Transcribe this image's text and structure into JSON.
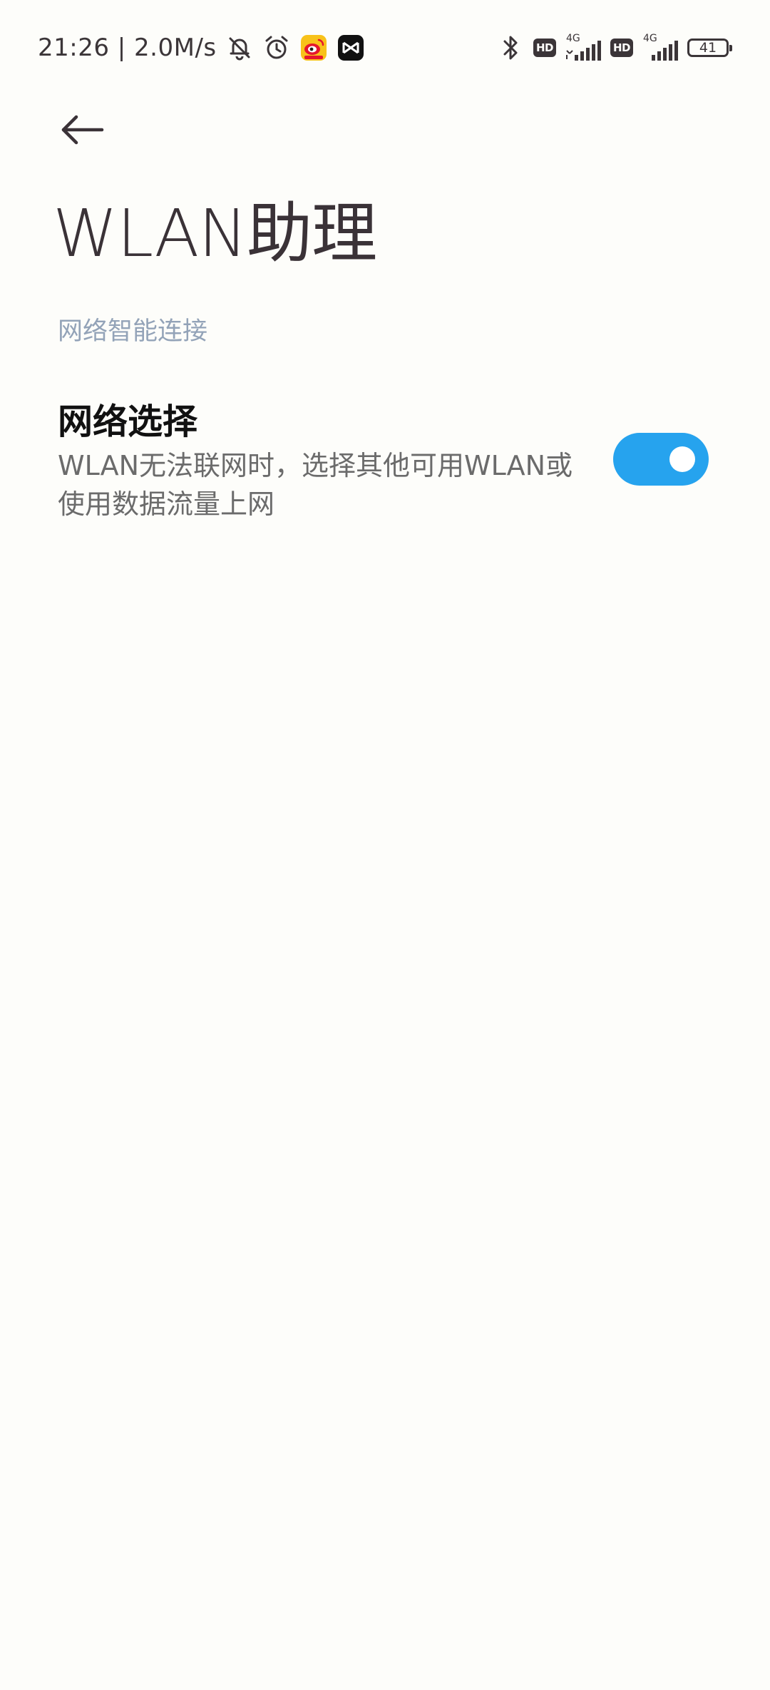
{
  "status_bar": {
    "time_speed": "21:26 | 2.0M/s",
    "icons": [
      "bell-off-icon",
      "alarm-icon",
      "weibo-app-icon",
      "capcut-app-icon",
      "bluetooth-icon",
      "hd-icon",
      "signal-icon",
      "hd-icon",
      "signal-icon",
      "battery-icon"
    ],
    "hd_label": "HD",
    "network_type": "4G",
    "battery_level": "41"
  },
  "header": {
    "back_icon": "arrow-left-icon",
    "title": "WLAN助理"
  },
  "section": {
    "header": "网络智能连接"
  },
  "setting": {
    "title": "网络选择",
    "summary": "WLAN无法联网时，选择其他可用WLAN或使用数据流量上网",
    "enabled": true
  },
  "colors": {
    "background": "#fdfdfa",
    "accent": "#26a3ee",
    "section_header": "#93a3b8",
    "text_primary": "#111111",
    "text_secondary": "#6b6b6b"
  }
}
